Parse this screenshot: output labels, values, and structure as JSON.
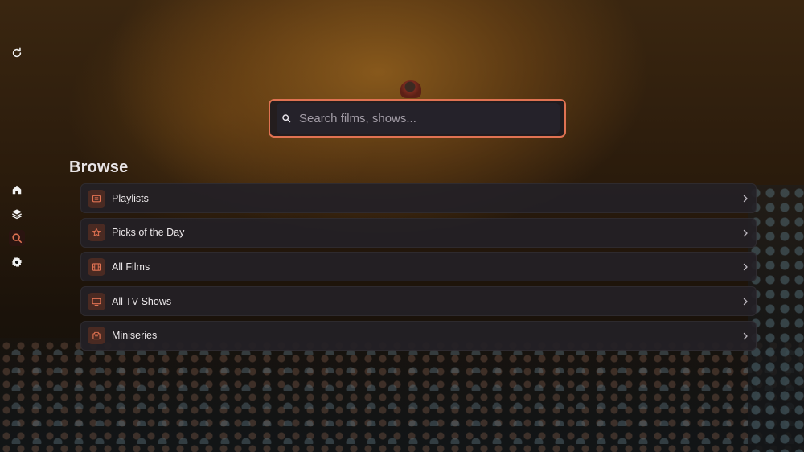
{
  "sidebar": {
    "items": [
      {
        "name": "refresh",
        "icon": "refresh-icon"
      },
      {
        "name": "home",
        "icon": "home-icon"
      },
      {
        "name": "library",
        "icon": "layers-icon"
      },
      {
        "name": "search",
        "icon": "search-icon",
        "active": true
      },
      {
        "name": "settings",
        "icon": "gear-icon"
      }
    ]
  },
  "search": {
    "placeholder": "Search films, shows...",
    "value": "",
    "border_color": "#e07252"
  },
  "browse": {
    "title": "Browse",
    "items": [
      {
        "label": "Playlists",
        "icon": "playlist-icon"
      },
      {
        "label": "Picks of the Day",
        "icon": "star-icon"
      },
      {
        "label": "All Films",
        "icon": "film-icon"
      },
      {
        "label": "All TV Shows",
        "icon": "tv-icon"
      },
      {
        "label": "Miniseries",
        "icon": "box-icon"
      }
    ]
  },
  "colors": {
    "accent": "#e07252",
    "row_icon_bg": "#4a2a22"
  }
}
